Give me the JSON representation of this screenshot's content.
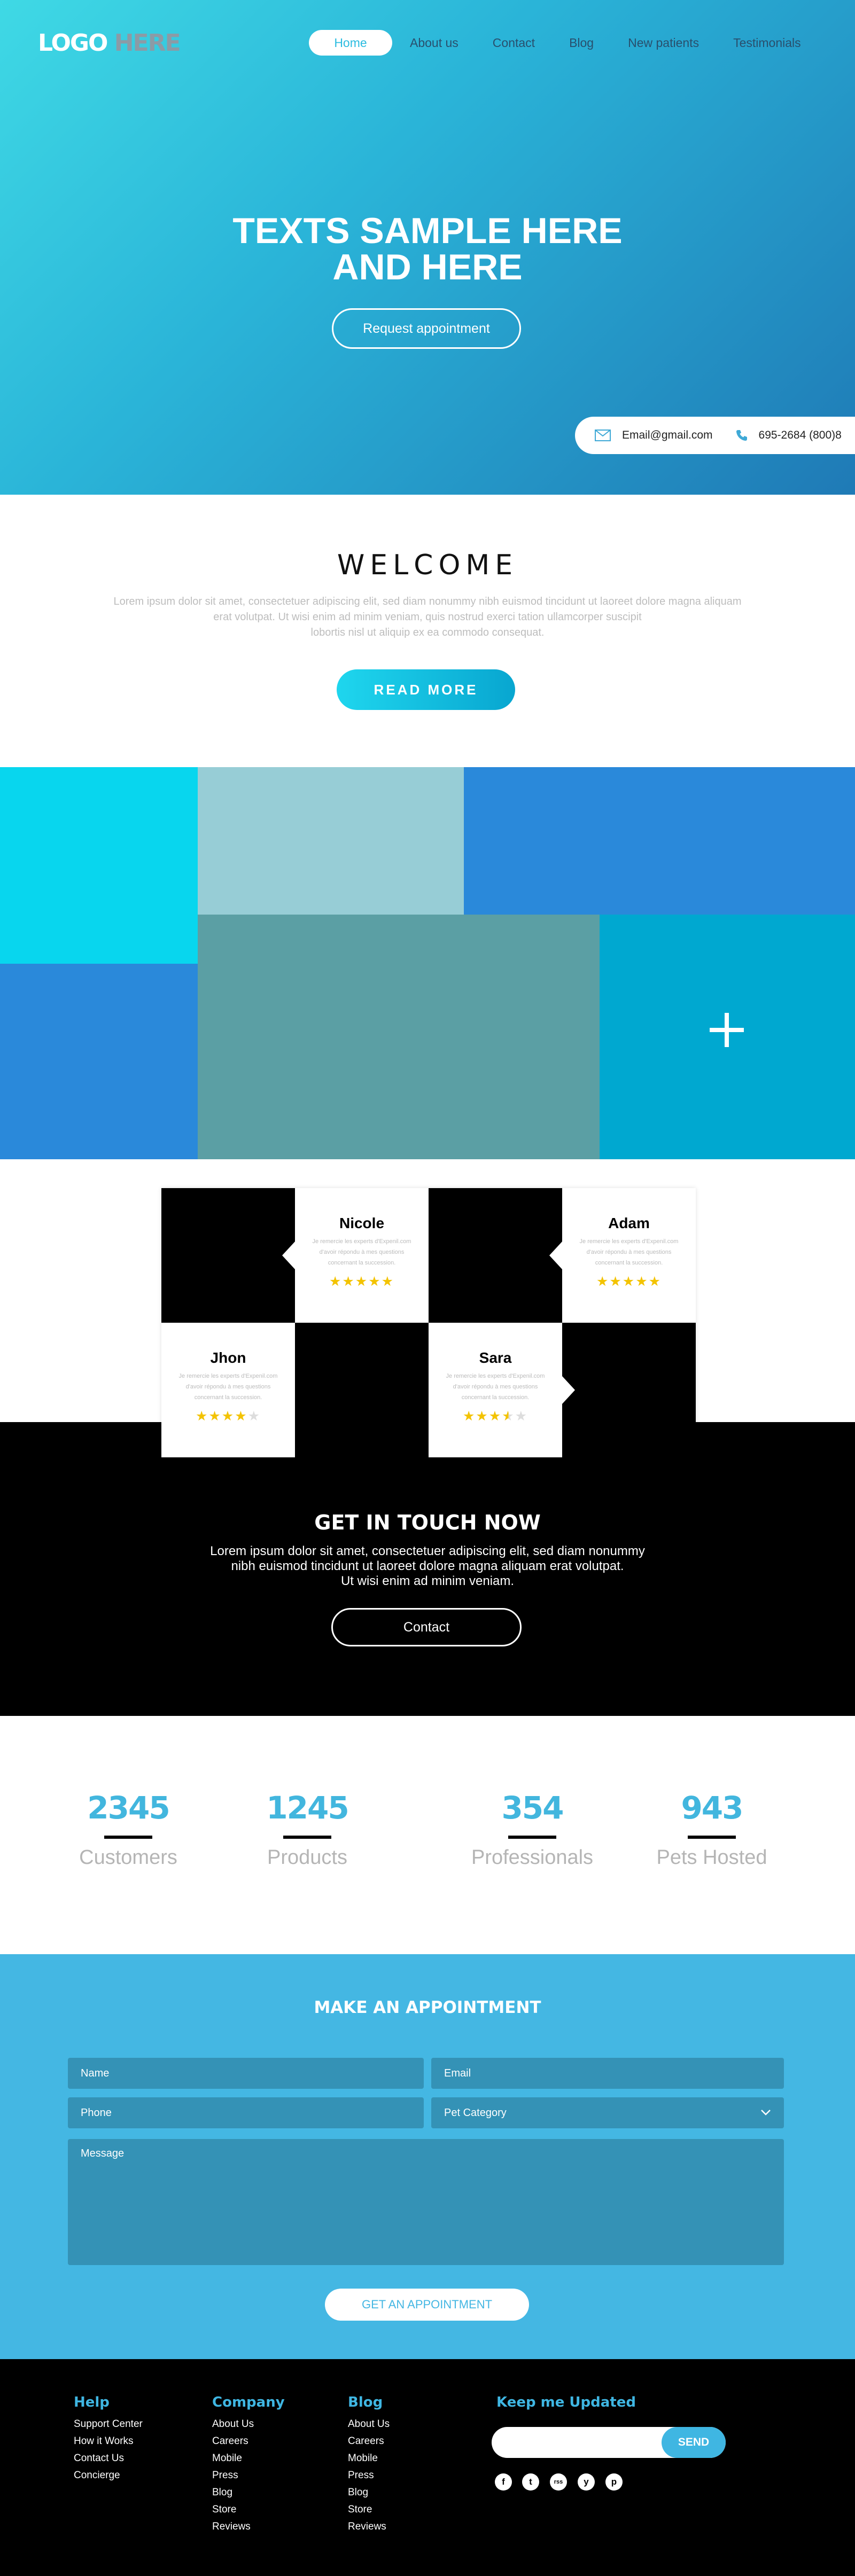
{
  "header": {
    "logo_part1": "LOGO",
    "logo_part2": "HERE",
    "nav": [
      "Home",
      "About us",
      "Contact",
      "Blog",
      "New patients",
      "Testimonials"
    ]
  },
  "hero": {
    "title_line1": "TEXTS SAMPLE HERE",
    "title_line2": "AND HERE",
    "button": "Request appointment",
    "email": "Email@gmail.com",
    "phone": "695-2684 (800)8"
  },
  "welcome": {
    "title": "WELCOME",
    "text_line1": "Lorem ipsum dolor sit amet, consectetuer adipiscing elit, sed diam nonummy nibh euismod tincidunt ut laoreet dolore magna aliquam",
    "text_line2": "erat volutpat. Ut wisi enim ad minim veniam, quis nostrud exerci tation ullamcorper suscipit",
    "text_line3": "lobortis nisl ut aliquip ex ea commodo consequat.",
    "button": "READ MORE"
  },
  "mosaic": {
    "colors": [
      "#08d6ee",
      "#97cdd6",
      "#2a89da",
      "#2a89da",
      "#5b9fa4",
      "#00a8d0"
    ]
  },
  "testimonials": [
    {
      "name": "Nicole",
      "text": "Je remercie les experts d'Expenil.com d'avoir répondu à mes questions concernant la succession.",
      "rating": 5
    },
    {
      "name": "Adam",
      "text": "Je remercie les experts d'Expenil.com d'avoir répondu à mes questions concernant la succession.",
      "rating": 5
    },
    {
      "name": "Jhon",
      "text": "Je remercie les experts d'Expenil.com d'avoir répondu à mes questions concernant la succession.",
      "rating": 4
    },
    {
      "name": "Sara",
      "text": "Je remercie les experts d'Expenil.com d'avoir répondu à mes questions concernant la succession.",
      "rating": 3.5
    }
  ],
  "touch": {
    "title": "GET IN TOUCH NOW",
    "text_line1": "Lorem ipsum dolor sit amet, consectetuer adipiscing elit, sed diam nonummy",
    "text_line2": "nibh euismod tincidunt ut laoreet dolore magna aliquam erat volutpat.",
    "text_line3": "Ut wisi enim ad minim veniam.",
    "button": "Contact"
  },
  "stats": [
    {
      "number": "2345",
      "label": "Customers"
    },
    {
      "number": "1245",
      "label": "Products"
    },
    {
      "number": "354",
      "label": "Professionals"
    },
    {
      "number": "943",
      "label": "Pets Hosted"
    }
  ],
  "appointment": {
    "title": "MAKE AN APPOINTMENT",
    "name_placeholder": "Name",
    "email_placeholder": "Email",
    "phone_placeholder": "Phone",
    "category_placeholder": "Pet Category",
    "message_placeholder": "Message",
    "button": "GET AN APPOINTMENT"
  },
  "footer": {
    "columns": [
      {
        "title": "Help",
        "links": [
          "Support Center",
          "How it Works",
          "Contact Us",
          "Concierge"
        ]
      },
      {
        "title": "Company",
        "links": [
          "About Us",
          "Careers",
          "Mobile",
          "Press",
          "Blog",
          "Store",
          "Reviews"
        ]
      },
      {
        "title": "Blog",
        "links": [
          "About Us",
          "Careers",
          "Mobile",
          "Press",
          "Blog",
          "Store",
          "Reviews"
        ]
      }
    ],
    "newsletter_title": "Keep me Updated",
    "send": "SEND",
    "social": [
      "f",
      "t",
      "rss",
      "y",
      "p"
    ]
  },
  "colors": {
    "accent": "#42b6de",
    "appointment_bg": "#44b7e3",
    "star": "#f3c300"
  }
}
